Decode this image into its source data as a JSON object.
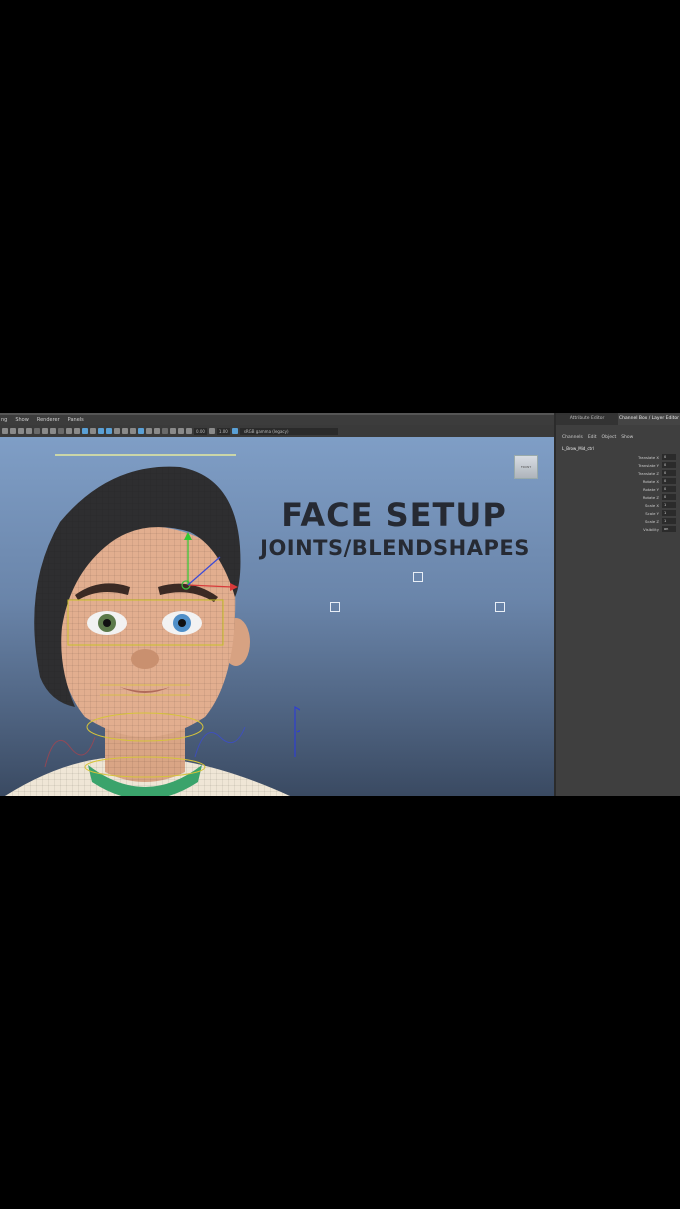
{
  "menu": [
    "ng",
    "Show",
    "Renderer",
    "Panels"
  ],
  "toolbar": {
    "field1": "0.00",
    "field2": "1.00",
    "colorspace": "sRGB gamma (legacy)"
  },
  "viewport": {
    "cube_label": "FRONT",
    "title_line1": "FACE SETUP",
    "title_line2": "JOINTS/BLENDSHAPES"
  },
  "panel": {
    "tabs": [
      "Attribute Editor",
      "Channel Box / Layer Editor"
    ],
    "channel_menu": [
      "Channels",
      "Edit",
      "Object",
      "Show"
    ],
    "object_name": "L_Brow_Mid_ctrl",
    "attributes": [
      {
        "label": "Translate X",
        "value": "0"
      },
      {
        "label": "Translate Y",
        "value": "0"
      },
      {
        "label": "Translate Z",
        "value": "0"
      },
      {
        "label": "Rotate X",
        "value": "0"
      },
      {
        "label": "Rotate Y",
        "value": "0"
      },
      {
        "label": "Rotate Z",
        "value": "0"
      },
      {
        "label": "Scale X",
        "value": "1"
      },
      {
        "label": "Scale Y",
        "value": "1"
      },
      {
        "label": "Scale Z",
        "value": "1"
      },
      {
        "label": "Visibility",
        "value": "on"
      }
    ]
  },
  "colors": {
    "background": "#000000",
    "viewport_top": "#7f9ec6",
    "viewport_bottom": "#3a4a62",
    "panel": "#3f3f3f",
    "title_text": "#262a33"
  }
}
